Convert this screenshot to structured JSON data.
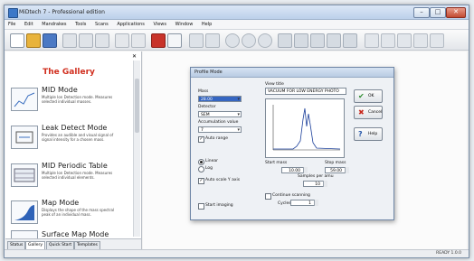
{
  "app": {
    "title": "MiDtech 7 - Professional edition"
  },
  "menu": [
    "File",
    "Edit",
    "Mandrakes",
    "Tools",
    "Scans",
    "Applications",
    "Views",
    "Window",
    "Help"
  ],
  "gallery": {
    "title": "The Gallery",
    "items": [
      {
        "name": "MID Mode",
        "desc": "Multiple Ion Detection mode. Measures selected individual masses."
      },
      {
        "name": "Leak Detect Mode",
        "desc": "Provides an audible and visual signal of signal intensity for a chosen mass."
      },
      {
        "name": "MID Periodic Table",
        "desc": "Multiple Ion Detection mode. Measures selected individual elements."
      },
      {
        "name": "Map Mode",
        "desc": "Displays the shape of the mass spectral peak of an individual mass."
      },
      {
        "name": "Surface Map Mode",
        "desc": ""
      }
    ],
    "tabs": [
      "Status",
      "Gallery",
      "Quick Start",
      "Templates"
    ]
  },
  "dialog": {
    "title": "Profile Mode",
    "mass_label": "Mass",
    "mass_value": "28.00",
    "detector_label": "Detector",
    "detector_value": "SEM",
    "acc_label": "Accumulation value",
    "acc_value": "7",
    "autorange_label": "Auto range",
    "linear_label": "Linear",
    "log_label": "Log",
    "auto_scale_label": "Auto scale Y axis",
    "view_title_label": "View title",
    "view_title_value": "VACUUM FOR LOW ENERGY PHOTO",
    "start_mass_label": "Start mass",
    "start_mass_value": "10.00",
    "stop_mass_label": "Stop mass",
    "stop_mass_value": "59.00",
    "sample_label": "Samples per amu",
    "sample_value": "10",
    "cont_label": "Continue scanning",
    "cycles_label": "Cycles",
    "cycles_value": "1",
    "start_imaging_label": "Start imaging",
    "ok_label": "OK",
    "cancel_label": "Cancel",
    "help_label": "Help"
  },
  "status": {
    "text": "READY 1.0.0"
  },
  "colors": {
    "accent": "#d12f1f",
    "selection": "#3566c2",
    "ok": "#2e8b2e",
    "cancel": "#c7281d"
  }
}
